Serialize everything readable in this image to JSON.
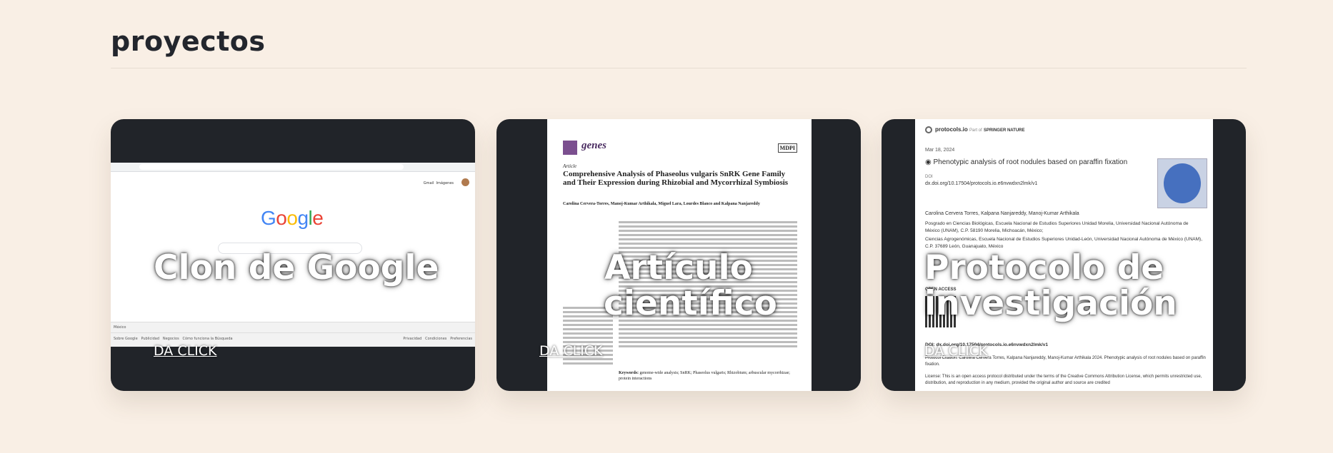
{
  "section": {
    "title": "proyectos"
  },
  "projects": [
    {
      "title": "Clon de Google",
      "link": "DA CLICK",
      "preview": {
        "logo": "Google",
        "header_links": [
          "Gmail",
          "Imágenes"
        ],
        "country": "México",
        "footer_left": [
          "Sobre Google",
          "Publicidad",
          "Negocios",
          "Cómo funciona la Búsqueda"
        ],
        "footer_right": [
          "Privacidad",
          "Condiciones",
          "Preferencias"
        ]
      }
    },
    {
      "title": "Artículo científico",
      "link": "DA CLICK",
      "preview": {
        "journal": "genes",
        "publisher": "MDPI",
        "kind": "Article",
        "paper_title": "Comprehensive Analysis of Phaseolus vulgaris SnRK Gene Family and Their Expression during Rhizobial and Mycorrhizal Symbiosis",
        "authors": "Carolina Cervera-Torres, Manoj-Kumar Arthikala, Miguel Lara, Lourdes Blanco and Kalpana Nanjareddy",
        "keywords_label": "Keywords:",
        "keywords": "genome-wide analysis; SnRK; Phaseolus vulgaris; Rhizobium; arbuscular mycorrhizae; protein interactions"
      }
    },
    {
      "title": "Protocolo de investigación",
      "link": "DA CLICK",
      "preview": {
        "brand": "protocols.io",
        "partof": "Part of",
        "springer": "SPRINGER NATURE",
        "date": "Mar 18, 2024",
        "heading": "Phenotypic analysis of root nodules based on paraffin fixation",
        "doi_label": "DOI",
        "doi": "dx.doi.org/10.17504/protocols.io.e6nvwdxn2lmk/v1",
        "authors": "Carolina Cervera Torres, Kalpana Nanjareddy, Manoj-Kumar Arthikala",
        "affil1": "Posgrado en Ciencias Biológicas, Escuela Nacional de Estudios Superiores Unidad Morelia, Universidad Nacional Autónoma de México (UNAM), C.P. 58190 Morelia, Michoacán, México;",
        "affil2": "Ciencias Agrogenómicas, Escuela Nacional de Estudios Superiores Unidad-León, Universidad Nacional Autónoma de México (UNAM), C.P. 37689 León, Guanajuato, México",
        "open_access": "OPEN ACCESS",
        "doi_full": "DOI: dx.doi.org/10.17504/protocols.io.e6nvwdxn2lmk/v1",
        "citation": "Protocol Citation: Carolina Cervera Torres, Kalpana Nanjareddy, Manoj-Kumar Arthikala 2024. Phenotypic analysis of root nodules based on paraffin fixation.",
        "license": "License: This is an open access protocol distributed under the terms of the Creative Commons Attribution License, which permits unrestricted use, distribution, and reproduction in any medium, provided the original author and source are credited"
      }
    }
  ]
}
